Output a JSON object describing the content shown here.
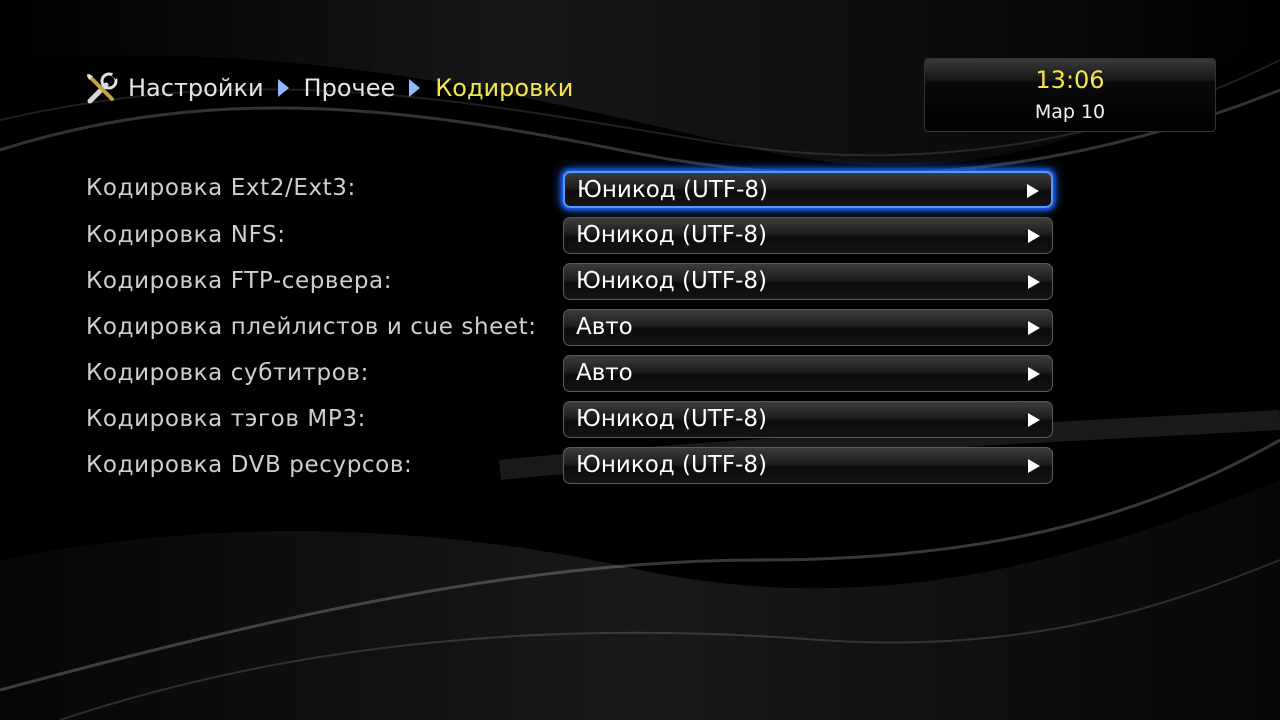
{
  "breadcrumb": {
    "items": [
      "Настройки",
      "Прочее",
      "Кодировки"
    ],
    "icon": "tools-icon"
  },
  "clock": {
    "time": "13:06",
    "date": "Мар 10"
  },
  "colors": {
    "accent": "#f4e64a",
    "focus": "#4f9bff",
    "separator": "#8fb7ff"
  },
  "settings": [
    {
      "label": "Кодировка Ext2/Ext3:",
      "value": "Юникод (UTF-8)",
      "focused": true
    },
    {
      "label": "Кодировка NFS:",
      "value": "Юникод (UTF-8)",
      "focused": false
    },
    {
      "label": "Кодировка FTP-сервера:",
      "value": "Юникод (UTF-8)",
      "focused": false
    },
    {
      "label": "Кодировка плейлистов и cue sheet:",
      "value": "Авто",
      "focused": false
    },
    {
      "label": "Кодировка субтитров:",
      "value": "Авто",
      "focused": false
    },
    {
      "label": "Кодировка тэгов MP3:",
      "value": "Юникод (UTF-8)",
      "focused": false
    },
    {
      "label": "Кодировка DVB ресурсов:",
      "value": "Юникод (UTF-8)",
      "focused": false
    }
  ]
}
